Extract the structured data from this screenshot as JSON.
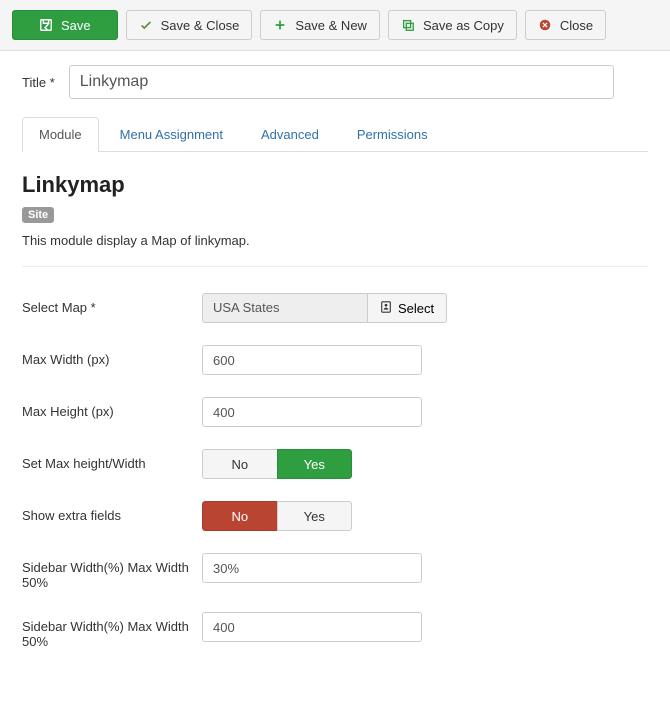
{
  "toolbar": {
    "save": "Save",
    "save_close": "Save & Close",
    "save_new": "Save & New",
    "save_copy": "Save as Copy",
    "close": "Close"
  },
  "title": {
    "label": "Title *",
    "value": "Linkymap"
  },
  "tabs": [
    "Module",
    "Menu Assignment",
    "Advanced",
    "Permissions"
  ],
  "module": {
    "heading": "Linkymap",
    "badge": "Site",
    "description": "This module display a Map of linkymap."
  },
  "fields": {
    "select_map": {
      "label": "Select Map *",
      "value": "USA States",
      "button": "Select"
    },
    "max_width": {
      "label": "Max Width (px)",
      "value": "600"
    },
    "max_height": {
      "label": "Max Height (px)",
      "value": "400"
    },
    "set_max": {
      "label": "Set Max height/Width",
      "no": "No",
      "yes": "Yes",
      "value": "yes"
    },
    "show_extra": {
      "label": "Show extra fields",
      "no": "No",
      "yes": "Yes",
      "value": "no"
    },
    "sidebar_width": {
      "label": "Sidebar Width(%) Max Width 50%",
      "value": "30%"
    },
    "sidebar_width2": {
      "label": "Sidebar Width(%) Max Width 50%",
      "value": "400"
    }
  }
}
